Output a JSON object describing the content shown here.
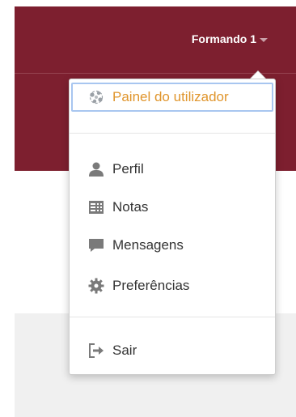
{
  "header": {
    "user_name": "Formando 1",
    "colors": {
      "brand": "#7d1f2f",
      "accent": "#e0952c"
    }
  },
  "menu": {
    "dashboard": {
      "label": "Painel do utilizador",
      "icon": "dashboard-icon"
    },
    "items": [
      {
        "label": "Perfil",
        "icon": "user-icon"
      },
      {
        "label": "Notas",
        "icon": "grades-icon"
      },
      {
        "label": "Mensagens",
        "icon": "message-icon"
      },
      {
        "label": "Preferências",
        "icon": "gear-icon"
      }
    ],
    "logout": {
      "label": "Sair",
      "icon": "logout-icon"
    }
  }
}
